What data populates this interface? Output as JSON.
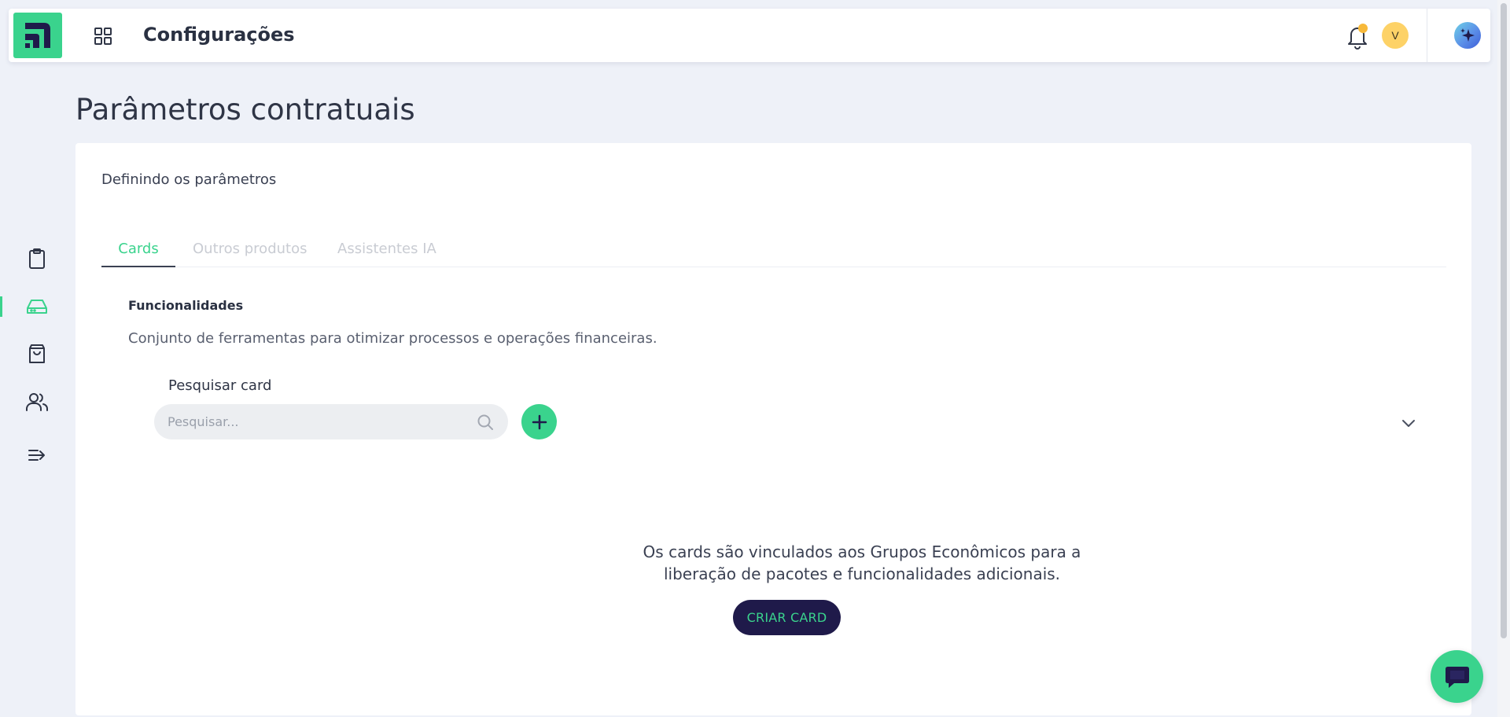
{
  "colors": {
    "accent_green": "#3ad38d",
    "navy": "#1f1a4a",
    "bell_dot": "#f7b93a",
    "avatar_bg": "#fdd267",
    "tab_inactive": "#c9ccd3"
  },
  "header": {
    "title": "Configurações",
    "avatar_initial": "V"
  },
  "sidebar": {
    "items": [
      {
        "icon": "clipboard-icon"
      },
      {
        "icon": "hard-drive-icon",
        "active": true
      },
      {
        "icon": "shopping-bag-icon"
      },
      {
        "icon": "users-icon"
      },
      {
        "icon": "list-arrow-icon"
      }
    ]
  },
  "page": {
    "title": "Parâmetros contratuais"
  },
  "card": {
    "subtitle": "Definindo os parâmetros",
    "tabs": [
      {
        "label": "Cards",
        "active": true
      },
      {
        "label": "Outros produtos",
        "active": false
      },
      {
        "label": "Assistentes IA",
        "active": false
      }
    ],
    "section_heading": "Funcionalidades",
    "section_description": "Conjunto de ferramentas para otimizar processos e operações financeiras.",
    "search": {
      "label": "Pesquisar card",
      "placeholder": "Pesquisar...",
      "value": ""
    },
    "empty_state": {
      "line1": "Os cards são vinculados aos Grupos Econômicos para a",
      "line2": "liberação de pacotes e funcionalidades adicionais.",
      "button_label": "CRIAR CARD"
    }
  }
}
